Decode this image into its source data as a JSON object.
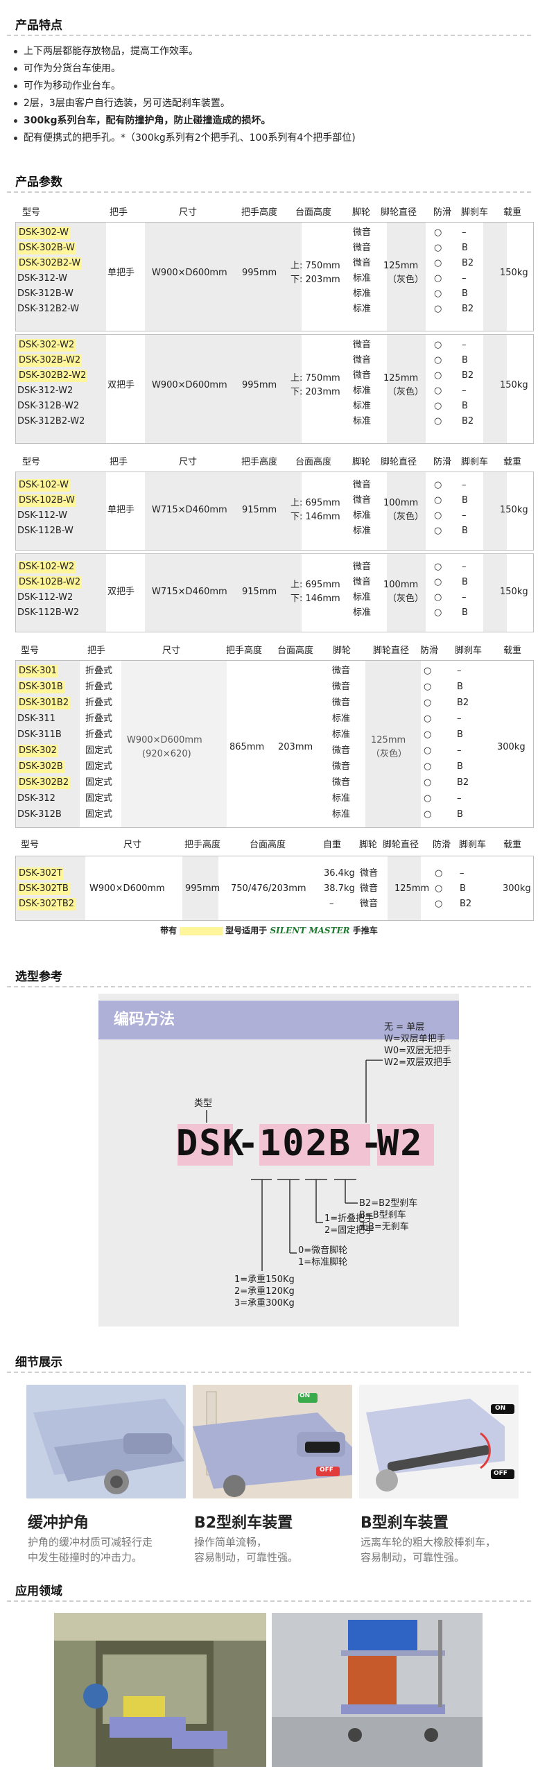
{
  "features": {
    "title": "产品特点",
    "items": [
      "上下两层都能存放物品，提高工作效率。",
      "可作为分货台车使用。",
      "可作为移动作业台车。",
      "2层，3层由客户自行选装，另可选配刹车装置。",
      "300kg系列台车，配有防撞护角，防止碰撞造成的损坏。",
      "配有便携式的把手孔。*（300kg系列有2个把手孔、100系列有4个把手部位)"
    ]
  },
  "params": {
    "title": "产品参数"
  },
  "headers": {
    "model": "型号",
    "handle": "把手",
    "size": "尺寸",
    "handle_h": "把手高度",
    "deck_h": "台面高度",
    "caster": "脚轮",
    "dia": "脚轮直径",
    "anti": "防滑",
    "brake": "脚刹车",
    "load": "载重",
    "weight": "自重"
  },
  "t1": {
    "models": [
      "DSK-302-W",
      "DSK-302B-W",
      "DSK-302B2-W",
      "DSK-312-W",
      "DSK-312B-W",
      "DSK-312B2-W"
    ],
    "hl": [
      true,
      true,
      true,
      false,
      false,
      false
    ],
    "handle": "单把手",
    "size": "W900×D600mm",
    "handle_h": "995mm",
    "deck_up": "上: 750mm",
    "deck_down": "下: 203mm",
    "casters": [
      "微音",
      "微音",
      "微音",
      "标准",
      "标准",
      "标准"
    ],
    "dia": "125mm",
    "dia_note": "（灰色）",
    "anti": [
      "○",
      "○",
      "○",
      "○",
      "○",
      "○"
    ],
    "brake": [
      "–",
      "B",
      "B2",
      "–",
      "B",
      "B2"
    ],
    "load": "150kg"
  },
  "t2": {
    "models": [
      "DSK-302-W2",
      "DSK-302B-W2",
      "DSK-302B2-W2",
      "DSK-312-W2",
      "DSK-312B-W2",
      "DSK-312B2-W2"
    ],
    "hl": [
      true,
      true,
      true,
      false,
      false,
      false
    ],
    "handle": "双把手",
    "size": "W900×D600mm",
    "handle_h": "995mm",
    "deck_up": "上: 750mm",
    "deck_down": "下: 203mm",
    "casters": [
      "微音",
      "微音",
      "微音",
      "标准",
      "标准",
      "标准"
    ],
    "dia": "125mm",
    "dia_note": "（灰色）",
    "anti": [
      "○",
      "○",
      "○",
      "○",
      "○",
      "○"
    ],
    "brake": [
      "–",
      "B",
      "B2",
      "–",
      "B",
      "B2"
    ],
    "load": "150kg"
  },
  "t3": {
    "models": [
      "DSK-102-W",
      "DSK-102B-W",
      "DSK-112-W",
      "DSK-112B-W"
    ],
    "hl": [
      true,
      true,
      false,
      false
    ],
    "handle": "单把手",
    "size": "W715×D460mm",
    "handle_h": "915mm",
    "deck_up": "上: 695mm",
    "deck_down": "下: 146mm",
    "casters": [
      "微音",
      "微音",
      "标准",
      "标准"
    ],
    "dia": "100mm",
    "dia_note": "（灰色）",
    "anti": [
      "○",
      "○",
      "○",
      "○"
    ],
    "brake": [
      "–",
      "B",
      "–",
      "B"
    ],
    "load": "150kg"
  },
  "t4": {
    "models": [
      "DSK-102-W2",
      "DSK-102B-W2",
      "DSK-112-W2",
      "DSK-112B-W2"
    ],
    "hl": [
      true,
      true,
      false,
      false
    ],
    "handle": "双把手",
    "size": "W715×D460mm",
    "handle_h": "915mm",
    "deck_up": "上: 695mm",
    "deck_down": "下: 146mm",
    "casters": [
      "微音",
      "微音",
      "标准",
      "标准"
    ],
    "dia": "100mm",
    "dia_note": "（灰色）",
    "anti": [
      "○",
      "○",
      "○",
      "○"
    ],
    "brake": [
      "–",
      "B",
      "–",
      "B"
    ],
    "load": "150kg"
  },
  "t5": {
    "models": [
      "DSK-301",
      "DSK-301B",
      "DSK-301B2",
      "DSK-311",
      "DSK-311B",
      "DSK-302",
      "DSK-302B",
      "DSK-302B2",
      "DSK-312",
      "DSK-312B"
    ],
    "hl": [
      true,
      true,
      true,
      false,
      false,
      true,
      true,
      true,
      false,
      false
    ],
    "handles": [
      "折叠式",
      "折叠式",
      "折叠式",
      "折叠式",
      "折叠式",
      "固定式",
      "固定式",
      "固定式",
      "固定式",
      "固定式"
    ],
    "size": "W900×D600mm",
    "size_note": "(920×620)",
    "handle_h": "865mm",
    "deck": "203mm",
    "casters": [
      "微音",
      "微音",
      "微音",
      "标准",
      "标准",
      "微音",
      "微音",
      "微音",
      "标准",
      "标准"
    ],
    "dia": "125mm",
    "dia_note": "（灰色）",
    "anti": [
      "○",
      "○",
      "○",
      "○",
      "○",
      "○",
      "○",
      "○",
      "○",
      "○"
    ],
    "brake": [
      "–",
      "B",
      "B2",
      "–",
      "B",
      "–",
      "B",
      "B2",
      "–",
      "B"
    ],
    "load": "300kg"
  },
  "t6": {
    "models": [
      "DSK-302T",
      "DSK-302TB",
      "DSK-302TB2"
    ],
    "hl": [
      true,
      true,
      true
    ],
    "size": "W900×D600mm",
    "handle_h": "995mm",
    "deck": "750/476/203mm",
    "deck3": "–",
    "weights": [
      "36.4kg",
      "38.7kg"
    ],
    "casters": [
      "微音",
      "微音",
      "微音"
    ],
    "dia": "125mm",
    "anti": [
      "○",
      "○",
      "○"
    ],
    "brake": [
      "–",
      "B",
      "B2"
    ],
    "load": "300kg"
  },
  "legend": {
    "pre": "带有",
    "mid": "型号适用于",
    "brand": "SILENT MASTER",
    "post": "手推车"
  },
  "selection": {
    "title": "选型参考",
    "panel_title": "编码方法",
    "p1": "DSK",
    "dash1": "-",
    "p2": "102B",
    "dash2": "-",
    "p3": "W2",
    "type_label": "类型",
    "opt_w": [
      "无 = 单层",
      "W=双层单把手",
      "W0=双层无把手",
      "W2=双层双把手"
    ],
    "opt_b": [
      "B2=B2型刹车",
      "B=B型刹车",
      "无B=无刹车"
    ],
    "opt_h": [
      "1=折叠把手",
      "2=固定把手"
    ],
    "opt_c": [
      "0=微音脚轮",
      "1=标准脚轮"
    ],
    "opt_l": [
      "1=承重150Kg",
      "2=承重120Kg",
      "3=承重300Kg"
    ]
  },
  "details": {
    "title": "细节展示",
    "items": [
      {
        "title": "缓冲护角",
        "desc": [
          "护角的缓冲材质可减轻行走",
          "中发生碰撞时的冲击力。"
        ]
      },
      {
        "title": "B2型刹车装置",
        "desc": [
          "操作简单流畅，",
          "容易制动，可靠性强。"
        ]
      },
      {
        "title": "B型刹车装置",
        "desc": [
          "远离车轮的粗大橡胶棒刹车，",
          "容易制动，可靠性强。"
        ]
      }
    ],
    "on": "ON",
    "off": "OFF"
  },
  "applications": {
    "title": "应用领域"
  },
  "colors": {
    "highlight": "#fff59a",
    "panel_head": "#aeb0d8",
    "pink": "#f2c3d2"
  }
}
